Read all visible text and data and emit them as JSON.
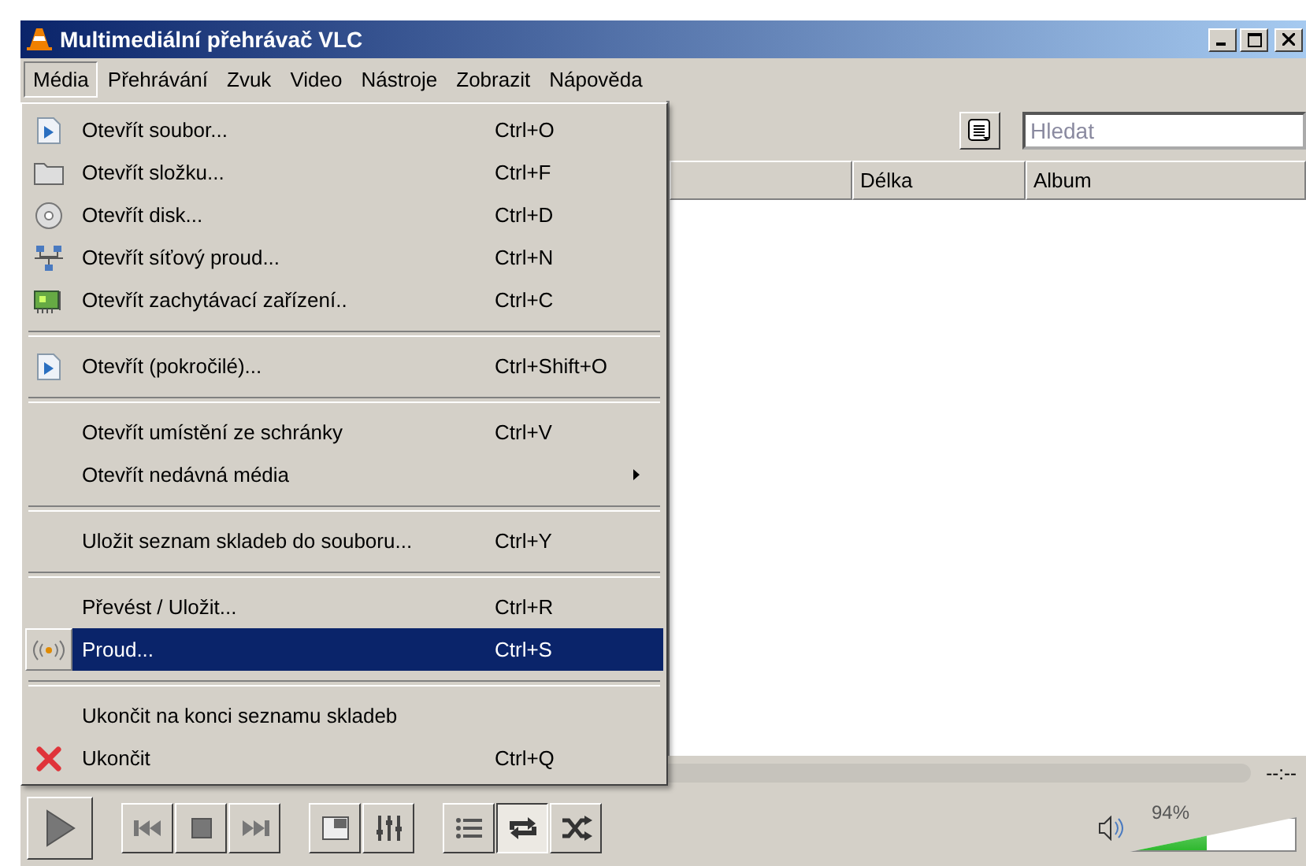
{
  "window": {
    "title": "Multimediální přehrávač VLC"
  },
  "menu_bar": [
    {
      "label": "Média",
      "selected": true
    },
    {
      "label": "Přehrávání",
      "selected": false
    },
    {
      "label": "Zvuk",
      "selected": false
    },
    {
      "label": "Video",
      "selected": false
    },
    {
      "label": "Nástroje",
      "selected": false
    },
    {
      "label": "Zobrazit",
      "selected": false
    },
    {
      "label": "Nápověda",
      "selected": false
    }
  ],
  "media_menu": [
    {
      "kind": "item",
      "label": "Otevřít soubor...",
      "shortcut": "Ctrl+O",
      "selected": false
    },
    {
      "kind": "item",
      "label": "Otevřít složku...",
      "shortcut": "Ctrl+F",
      "selected": false
    },
    {
      "kind": "item",
      "label": "Otevřít disk...",
      "shortcut": "Ctrl+D",
      "selected": false
    },
    {
      "kind": "item",
      "label": "Otevřít síťový proud...",
      "shortcut": "Ctrl+N",
      "selected": false
    },
    {
      "kind": "item",
      "label": "Otevřít zachytávací zařízení..",
      "shortcut": "Ctrl+C",
      "selected": false
    },
    {
      "kind": "separator"
    },
    {
      "kind": "item",
      "label": "Otevřít (pokročilé)...",
      "shortcut": "Ctrl+Shift+O",
      "selected": false
    },
    {
      "kind": "separator"
    },
    {
      "kind": "item",
      "label": "Otevřít umístění ze schránky",
      "shortcut": "Ctrl+V",
      "selected": false
    },
    {
      "kind": "item",
      "label": "Otevřít nedávná média",
      "submenu": true,
      "selected": false
    },
    {
      "kind": "separator"
    },
    {
      "kind": "item",
      "label": "Uložit seznam skladeb do souboru...",
      "shortcut": "Ctrl+Y",
      "selected": false
    },
    {
      "kind": "separator"
    },
    {
      "kind": "item",
      "label": "Převést / Uložit...",
      "shortcut": "Ctrl+R",
      "selected": false
    },
    {
      "kind": "item",
      "label": "Proud...",
      "shortcut": "Ctrl+S",
      "selected": true
    },
    {
      "kind": "separator"
    },
    {
      "kind": "item",
      "label": "Ukončit na konci seznamu skladeb",
      "selected": false
    },
    {
      "kind": "item",
      "label": "Ukončit",
      "shortcut": "Ctrl+Q",
      "selected": false
    }
  ],
  "playlist": {
    "search": {
      "placeholder": "Hledat"
    },
    "columns": [
      "Délka",
      "Album"
    ]
  },
  "seek": {
    "time": "--:--"
  },
  "transport": [
    {
      "kind": "play"
    },
    {
      "kind": "previous"
    },
    {
      "kind": "stop"
    },
    {
      "kind": "next"
    },
    {
      "kind": "fullscreen"
    },
    {
      "kind": "settings"
    }
  ],
  "toggles": [
    {
      "kind": "playlist",
      "on": false
    },
    {
      "kind": "loop",
      "on": true
    },
    {
      "kind": "shuffle",
      "on": false
    }
  ],
  "volume": {
    "reading": "94%",
    "level": 0.46
  }
}
